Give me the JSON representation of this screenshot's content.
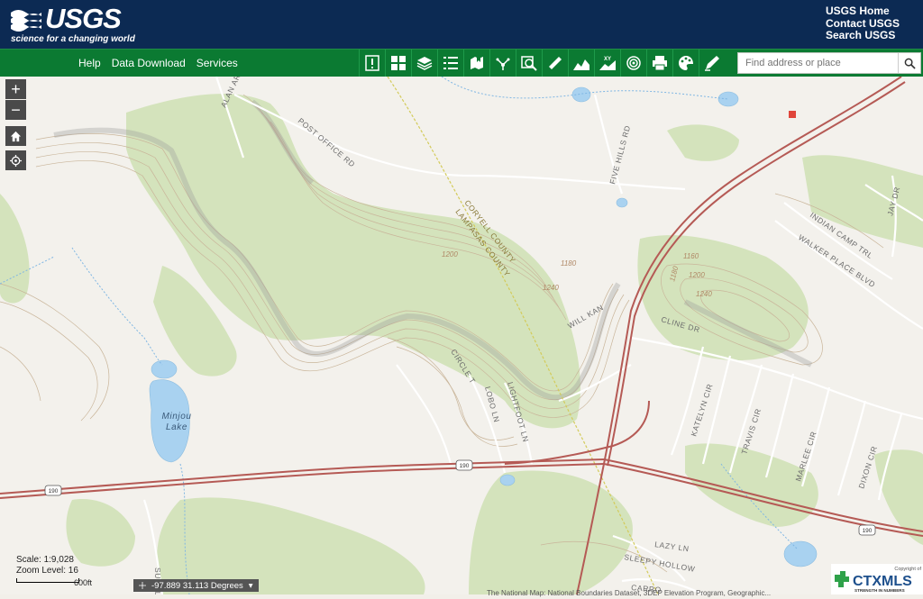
{
  "header": {
    "logo_text": "USGS",
    "logo_tagline": "science for a changing world",
    "links": [
      "USGS Home",
      "Contact USGS",
      "Search USGS"
    ]
  },
  "toolbar": {
    "menu": [
      "Help",
      "Data Download",
      "Services"
    ],
    "tools": [
      "alert-icon",
      "basemap-grid-icon",
      "layers-icon",
      "legend-list-icon",
      "bookmark-icon",
      "share-icon",
      "zoom-search-icon",
      "measure-icon",
      "profile-icon",
      "xy-icon",
      "target-icon",
      "print-icon",
      "palette-icon",
      "draw-icon"
    ],
    "search_placeholder": "Find address or place"
  },
  "map": {
    "water_labels": [
      "Minjou",
      "Lake"
    ],
    "road_labels": [
      "POST OFFICE RD",
      "FIVE HILLS RD",
      "CORYELL COUNTY",
      "LAMPASAS COUNTY",
      "CIRCLE T",
      "LOBO LN",
      "LIGHTFOOT LN",
      "WILL KAN",
      "CLINE DR",
      "INDIAN CAMP TRL",
      "WALKER PLACE BLVD",
      "JAY DR",
      "KATELYN CIR",
      "TRAVIS CIR",
      "MARLEE CIR",
      "DIXON CIR",
      "LAZY LN",
      "SLEEPY HOLLOW",
      "CARRO",
      "ALAN ARBO",
      "SUJA L"
    ],
    "contour_labels": [
      "1200",
      "1180",
      "1240",
      "1160",
      "1180",
      "1200",
      "1240"
    ],
    "route_shields": [
      "190",
      "190",
      "190"
    ],
    "accent_colors": {
      "header": "#0c2a53",
      "toolbar": "#0b7a32",
      "vegetation": "#cfe0b4",
      "water": "#a7d0ef",
      "highway": "#b24b47"
    }
  },
  "controls": {
    "zoom_in": "+",
    "zoom_out": "−"
  },
  "status": {
    "scale": "Scale: 1:9,028",
    "zoom_level": "Zoom Level: 16",
    "scale_bar_label": "600ft",
    "coordinates": "-97.889 31.113 Degrees",
    "coords_arrow": "▾",
    "attribution": "The National Map: National Boundaries Dataset, 3DEP Elevation Program, Geographic..."
  },
  "ctxmls": {
    "copyright": "Copyright of",
    "brand": "CTXMLS",
    "slogan": "STRENGTH IN NUMBERS"
  }
}
